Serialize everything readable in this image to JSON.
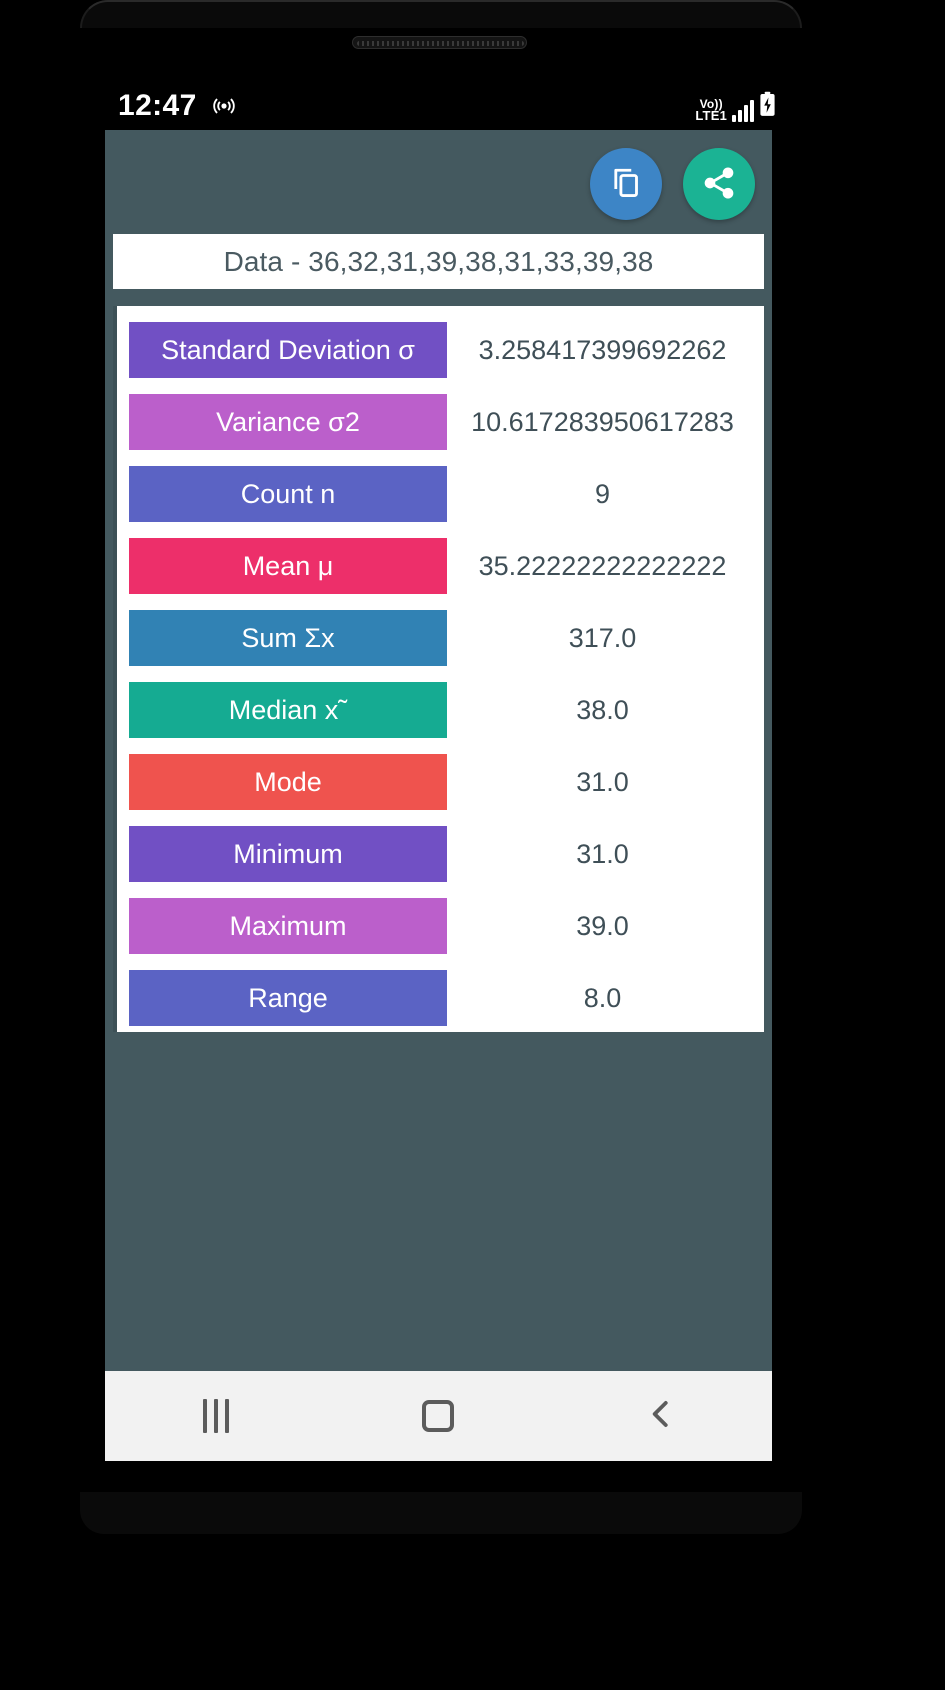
{
  "status_bar": {
    "time": "12:47",
    "hotspot_icon": "hotspot-icon",
    "network_top": "Vo))",
    "network_label": "LTE1",
    "signal_icon": "signal-bars-icon",
    "battery_icon": "battery-charging-icon"
  },
  "appbar": {
    "copy_label": "copy-icon",
    "share_label": "share-icon",
    "copy_color": "#3d85c6",
    "share_color": "#1bb394",
    "background_color": "#44595f"
  },
  "data_banner": {
    "text": "Data - 36,32,31,39,38,31,33,39,38"
  },
  "results": {
    "rows": [
      {
        "label": "Standard Deviation σ",
        "value": "3.258417399692262",
        "color": "#7150c4"
      },
      {
        "label": "Variance σ2",
        "value": "10.617283950617283",
        "color": "#bb5fcb"
      },
      {
        "label": "Count n",
        "value": "9",
        "color": "#5b63c4"
      },
      {
        "label": "Mean μ",
        "value": "35.22222222222222",
        "color": "#ed2f6a"
      },
      {
        "label": "Sum Σx",
        "value": "317.0",
        "color": "#3182b4"
      },
      {
        "label": "Median x˜",
        "value": "38.0",
        "color": "#15ab92"
      },
      {
        "label": "Mode",
        "value": "31.0",
        "color": "#ef534e"
      },
      {
        "label": "Minimum",
        "value": "31.0",
        "color": "#7150c4"
      },
      {
        "label": "Maximum",
        "value": "39.0",
        "color": "#bb5fcb"
      },
      {
        "label": "Range",
        "value": "8.0",
        "color": "#5b63c4"
      }
    ]
  },
  "navbar": {
    "recents_label": "recents-icon",
    "home_label": "home-icon",
    "back_label": "back-icon"
  }
}
